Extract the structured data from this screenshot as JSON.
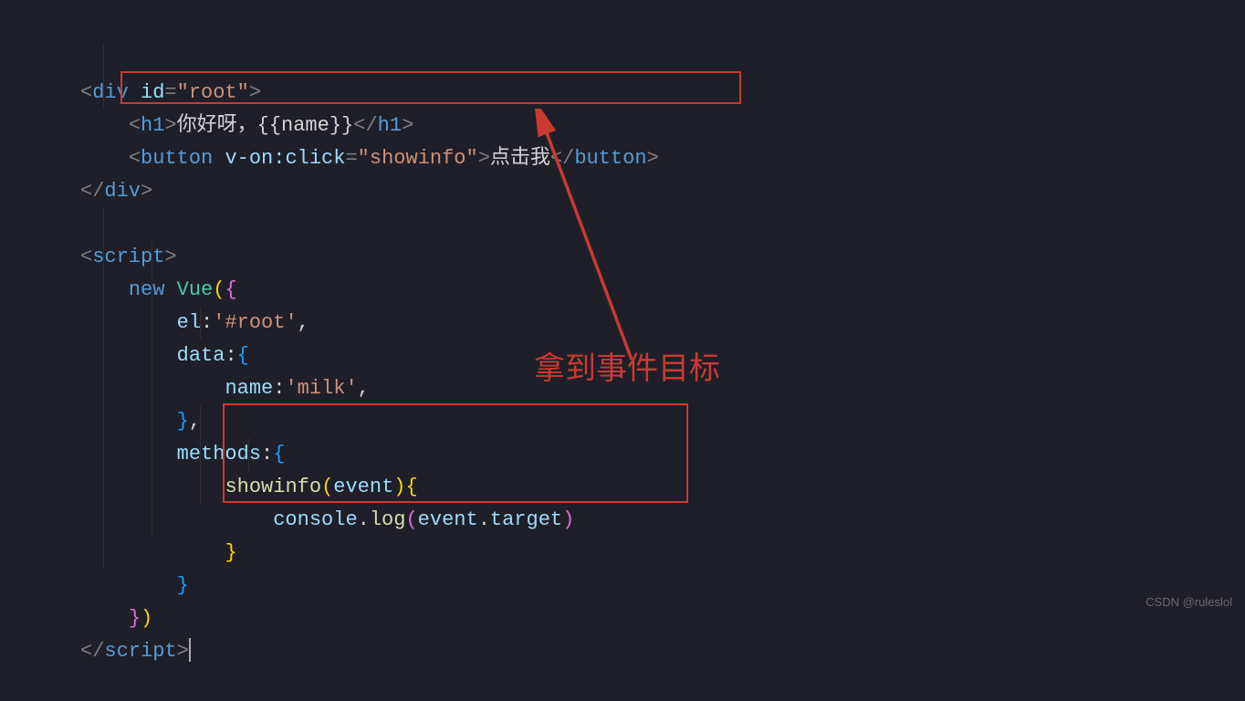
{
  "code": {
    "lines": [
      {
        "indent": 0,
        "html": "bracket:<;tag:div;text: ;attr:id;bracket:=;string:\"root\";bracket:>"
      },
      {
        "indent": 1,
        "html": "bracket:<;tag:h1;bracket:>;text:你好呀，{{name}};bracket:</;tag:h1;bracket:>"
      },
      {
        "indent": 1,
        "html": "bracket:<;tag:button;text: ;attr:v-on:click;bracket:=;string:\"showinfo\";bracket:>;text:点击我;bracket:</;tag:button;bracket:>"
      },
      {
        "indent": 0,
        "html": "bracket:</;tag:div;bracket:>"
      },
      {
        "indent": 0,
        "html": ""
      },
      {
        "indent": 0,
        "html": "bracket:<;tag:script;bracket:>"
      },
      {
        "indent": 1,
        "html": "keyword:new;text: ;class:Vue;brace-yellow:(;brace-purple:{"
      },
      {
        "indent": 2,
        "html": "prop:el;punct::;string:'#root';punct:,"
      },
      {
        "indent": 2,
        "html": "prop:data;punct::;brace-blue:{"
      },
      {
        "indent": 3,
        "html": "prop:name;punct::;string:'milk';punct:,"
      },
      {
        "indent": 2,
        "html": "brace-blue:};punct:,"
      },
      {
        "indent": 2,
        "html": "prop:methods;punct::;brace-blue:{"
      },
      {
        "indent": 3,
        "html": "func:showinfo;brace-yellow:(;param:event;brace-yellow:);brace-yellow:{"
      },
      {
        "indent": 4,
        "html": "obj:console;punct:.;func:log;brace-purple:(;param:event;punct:.;prop:target;brace-purple:);punct:;"
      },
      {
        "indent": 3,
        "html": "brace-yellow:}"
      },
      {
        "indent": 2,
        "html": "brace-blue:}"
      },
      {
        "indent": 1,
        "html": "brace-purple:};brace-yellow:)"
      },
      {
        "indent": 0,
        "html": "bracket:</;tag:script;bracket:>;cursor:"
      }
    ]
  },
  "annotation": {
    "text": "拿到事件目标"
  },
  "watermark": "CSDN @ruleslol"
}
